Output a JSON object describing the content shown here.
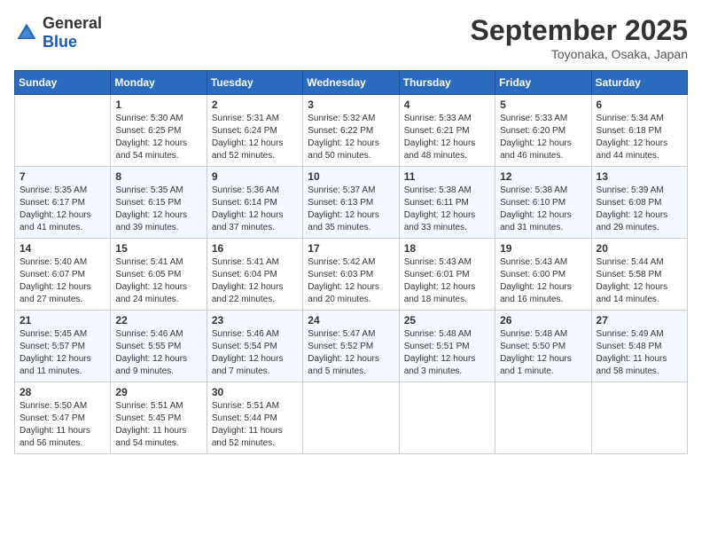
{
  "header": {
    "logo": {
      "general": "General",
      "blue": "Blue"
    },
    "title": "September 2025",
    "subtitle": "Toyonaka, Osaka, Japan"
  },
  "days_of_week": [
    "Sunday",
    "Monday",
    "Tuesday",
    "Wednesday",
    "Thursday",
    "Friday",
    "Saturday"
  ],
  "weeks": [
    [
      {
        "day": "",
        "info": ""
      },
      {
        "day": "1",
        "info": "Sunrise: 5:30 AM\nSunset: 6:25 PM\nDaylight: 12 hours\nand 54 minutes."
      },
      {
        "day": "2",
        "info": "Sunrise: 5:31 AM\nSunset: 6:24 PM\nDaylight: 12 hours\nand 52 minutes."
      },
      {
        "day": "3",
        "info": "Sunrise: 5:32 AM\nSunset: 6:22 PM\nDaylight: 12 hours\nand 50 minutes."
      },
      {
        "day": "4",
        "info": "Sunrise: 5:33 AM\nSunset: 6:21 PM\nDaylight: 12 hours\nand 48 minutes."
      },
      {
        "day": "5",
        "info": "Sunrise: 5:33 AM\nSunset: 6:20 PM\nDaylight: 12 hours\nand 46 minutes."
      },
      {
        "day": "6",
        "info": "Sunrise: 5:34 AM\nSunset: 6:18 PM\nDaylight: 12 hours\nand 44 minutes."
      }
    ],
    [
      {
        "day": "7",
        "info": "Sunrise: 5:35 AM\nSunset: 6:17 PM\nDaylight: 12 hours\nand 41 minutes."
      },
      {
        "day": "8",
        "info": "Sunrise: 5:35 AM\nSunset: 6:15 PM\nDaylight: 12 hours\nand 39 minutes."
      },
      {
        "day": "9",
        "info": "Sunrise: 5:36 AM\nSunset: 6:14 PM\nDaylight: 12 hours\nand 37 minutes."
      },
      {
        "day": "10",
        "info": "Sunrise: 5:37 AM\nSunset: 6:13 PM\nDaylight: 12 hours\nand 35 minutes."
      },
      {
        "day": "11",
        "info": "Sunrise: 5:38 AM\nSunset: 6:11 PM\nDaylight: 12 hours\nand 33 minutes."
      },
      {
        "day": "12",
        "info": "Sunrise: 5:38 AM\nSunset: 6:10 PM\nDaylight: 12 hours\nand 31 minutes."
      },
      {
        "day": "13",
        "info": "Sunrise: 5:39 AM\nSunset: 6:08 PM\nDaylight: 12 hours\nand 29 minutes."
      }
    ],
    [
      {
        "day": "14",
        "info": "Sunrise: 5:40 AM\nSunset: 6:07 PM\nDaylight: 12 hours\nand 27 minutes."
      },
      {
        "day": "15",
        "info": "Sunrise: 5:41 AM\nSunset: 6:05 PM\nDaylight: 12 hours\nand 24 minutes."
      },
      {
        "day": "16",
        "info": "Sunrise: 5:41 AM\nSunset: 6:04 PM\nDaylight: 12 hours\nand 22 minutes."
      },
      {
        "day": "17",
        "info": "Sunrise: 5:42 AM\nSunset: 6:03 PM\nDaylight: 12 hours\nand 20 minutes."
      },
      {
        "day": "18",
        "info": "Sunrise: 5:43 AM\nSunset: 6:01 PM\nDaylight: 12 hours\nand 18 minutes."
      },
      {
        "day": "19",
        "info": "Sunrise: 5:43 AM\nSunset: 6:00 PM\nDaylight: 12 hours\nand 16 minutes."
      },
      {
        "day": "20",
        "info": "Sunrise: 5:44 AM\nSunset: 5:58 PM\nDaylight: 12 hours\nand 14 minutes."
      }
    ],
    [
      {
        "day": "21",
        "info": "Sunrise: 5:45 AM\nSunset: 5:57 PM\nDaylight: 12 hours\nand 11 minutes."
      },
      {
        "day": "22",
        "info": "Sunrise: 5:46 AM\nSunset: 5:55 PM\nDaylight: 12 hours\nand 9 minutes."
      },
      {
        "day": "23",
        "info": "Sunrise: 5:46 AM\nSunset: 5:54 PM\nDaylight: 12 hours\nand 7 minutes."
      },
      {
        "day": "24",
        "info": "Sunrise: 5:47 AM\nSunset: 5:52 PM\nDaylight: 12 hours\nand 5 minutes."
      },
      {
        "day": "25",
        "info": "Sunrise: 5:48 AM\nSunset: 5:51 PM\nDaylight: 12 hours\nand 3 minutes."
      },
      {
        "day": "26",
        "info": "Sunrise: 5:48 AM\nSunset: 5:50 PM\nDaylight: 12 hours\nand 1 minute."
      },
      {
        "day": "27",
        "info": "Sunrise: 5:49 AM\nSunset: 5:48 PM\nDaylight: 11 hours\nand 58 minutes."
      }
    ],
    [
      {
        "day": "28",
        "info": "Sunrise: 5:50 AM\nSunset: 5:47 PM\nDaylight: 11 hours\nand 56 minutes."
      },
      {
        "day": "29",
        "info": "Sunrise: 5:51 AM\nSunset: 5:45 PM\nDaylight: 11 hours\nand 54 minutes."
      },
      {
        "day": "30",
        "info": "Sunrise: 5:51 AM\nSunset: 5:44 PM\nDaylight: 11 hours\nand 52 minutes."
      },
      {
        "day": "",
        "info": ""
      },
      {
        "day": "",
        "info": ""
      },
      {
        "day": "",
        "info": ""
      },
      {
        "day": "",
        "info": ""
      }
    ]
  ]
}
